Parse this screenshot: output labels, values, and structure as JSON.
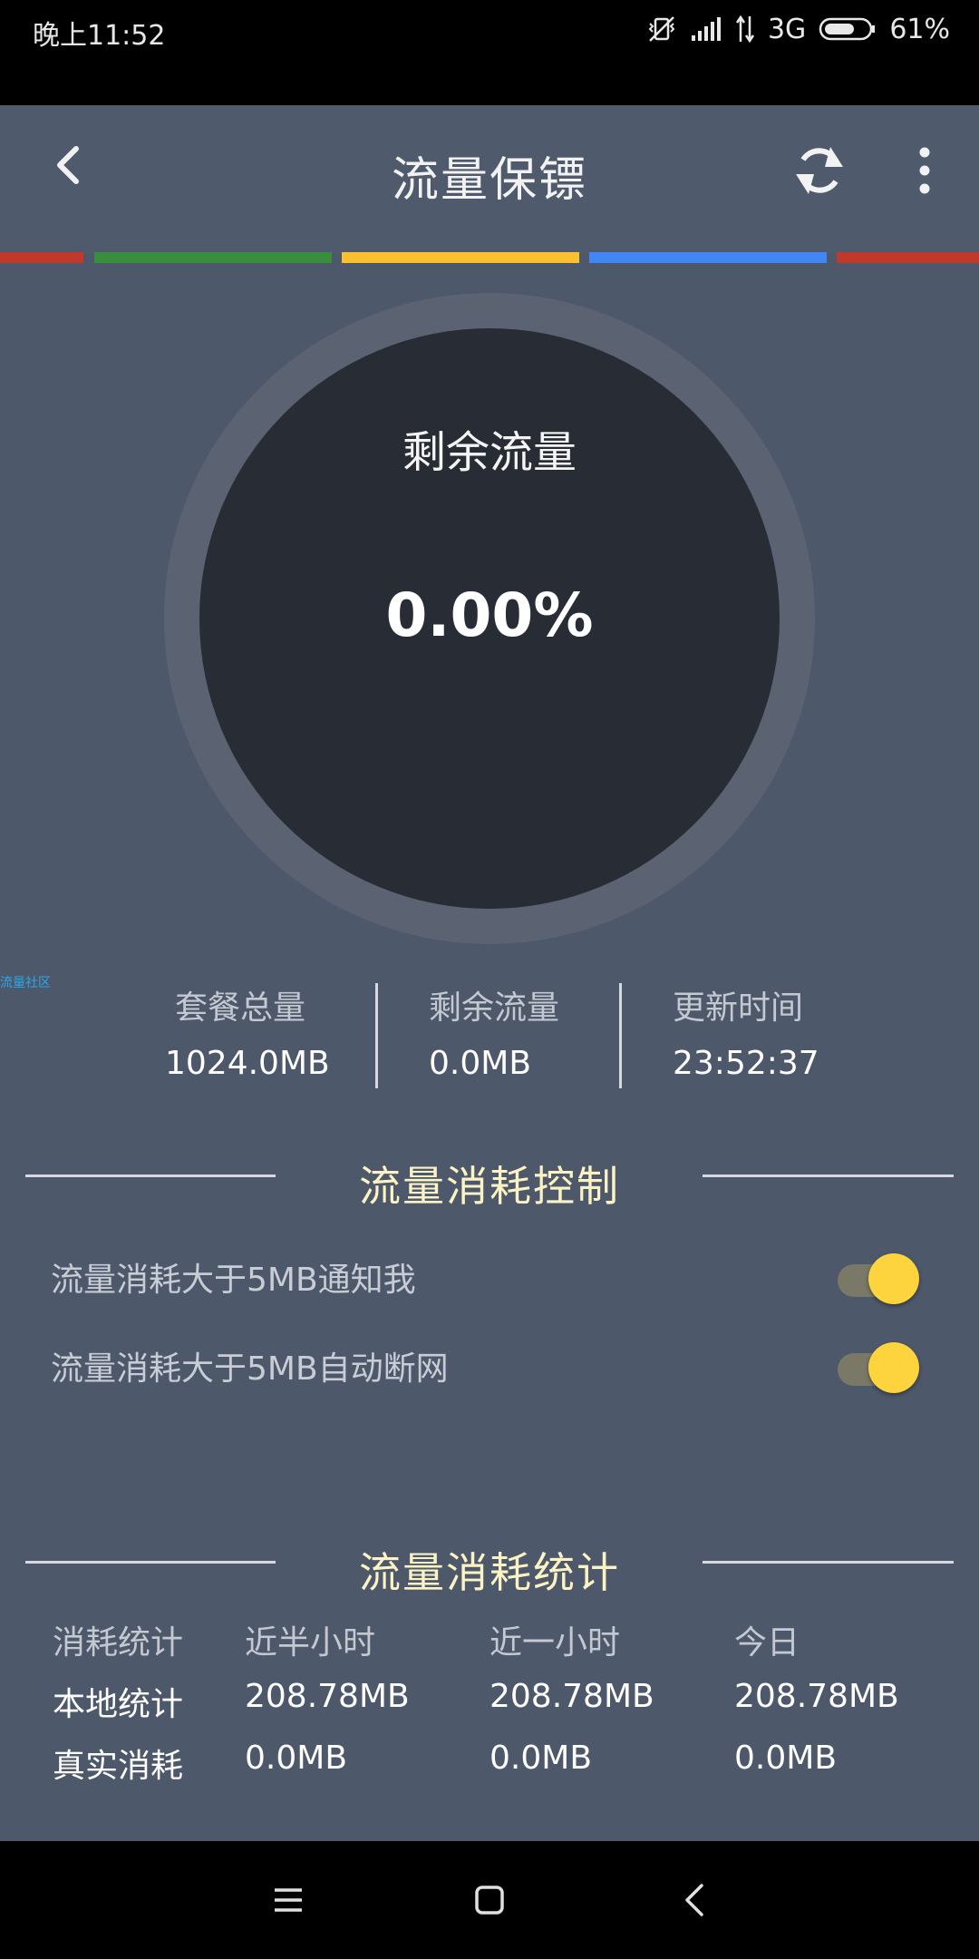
{
  "status_bar": {
    "time": "晚上11:52",
    "network": "3G",
    "battery": "61%"
  },
  "app_bar": {
    "title": "流量保镖"
  },
  "stripe_colors": [
    "#c0392b",
    "#388e3c",
    "#fbc02d",
    "#4285f4",
    "#c0392b"
  ],
  "gauge": {
    "label": "剩余流量",
    "value": "0.00%"
  },
  "watermark": "流量社区",
  "info": {
    "total_label": "套餐总量",
    "total_value": "1024.0MB",
    "remaining_label": "剩余流量",
    "remaining_value": "0.0MB",
    "updated_label": "更新时间",
    "updated_value": "23:52:37"
  },
  "control": {
    "title": "流量消耗控制",
    "notify_label": "流量消耗大于5MB通知我",
    "notify_on": true,
    "disconnect_label": "流量消耗大于5MB自动断网",
    "disconnect_on": true
  },
  "stats": {
    "title": "流量消耗统计",
    "headers": [
      "消耗统计",
      "近半小时",
      "近一小时",
      "今日"
    ],
    "rows": [
      [
        "本地统计",
        "208.78MB",
        "208.78MB",
        "208.78MB"
      ],
      [
        "真实消耗",
        "0.0MB",
        "0.0MB",
        "0.0MB"
      ]
    ]
  },
  "colors": {
    "accent_yellow": "#fdd33e",
    "section_title": "#fbf3c4",
    "background": "#4e586b"
  }
}
